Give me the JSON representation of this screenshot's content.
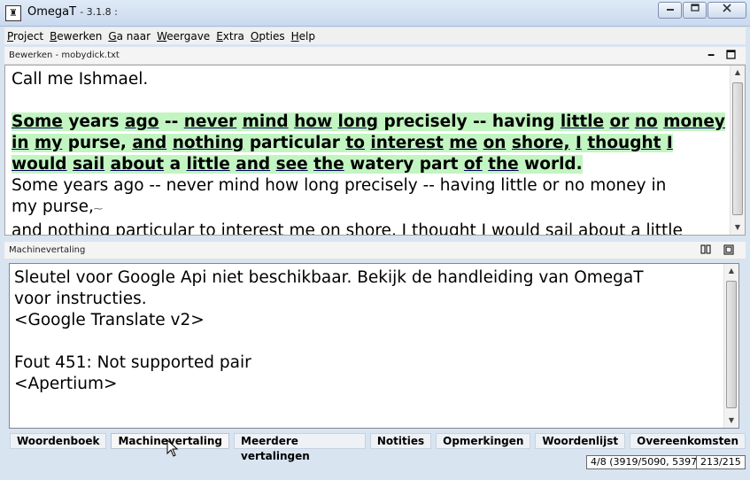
{
  "window": {
    "app_name": "OmegaT",
    "version": "- 3.1.8 :",
    "icon_glyph": "♜"
  },
  "menu": [
    {
      "first": "P",
      "rest": "roject"
    },
    {
      "first": "B",
      "rest": "ewerken"
    },
    {
      "first": "G",
      "rest": "a naar"
    },
    {
      "first": "W",
      "rest": "eergave"
    },
    {
      "first": "E",
      "rest": "xtra"
    },
    {
      "first": "O",
      "rest": "pties"
    },
    {
      "first": "H",
      "rest": "elp"
    }
  ],
  "editor": {
    "title": "Bewerken - mobydick.txt",
    "line1": "Call me Ishmael.",
    "source_segment": "Some years ago -- never mind how long precisely -- having little or no money in my purse, and nothing particular to interest me on shore, I thought I would sail about a little and see the watery part of the world.",
    "target_line1": "Some years ago -- never mind how long precisely -- having little or no money in",
    "target_line2": "my purse,",
    "target_line3": "and nothing particular to interest me on shore, I thought I would sail about a little"
  },
  "mt": {
    "title": "Machinevertaling",
    "text": "Sleutel voor Google Api niet beschikbaar. Bekijk de handleiding van OmegaT\nvoor instructies.\n<Google Translate v2>\n\nFout 451: Not supported pair\n<Apertium>"
  },
  "tabs": [
    "Woordenboek",
    "Machinevertaling",
    "Meerdere vertalingen",
    "Notities",
    "Opmerkingen",
    "Woordenlijst",
    "Overeenkomsten"
  ],
  "active_tab": "Machinevertaling",
  "status": {
    "progress": "4/8 (3919/5090, 5397)",
    "chars": "213/215"
  },
  "colors": {
    "active_segment_bg": "#c2f5c2",
    "glossary_underline": "#00005a"
  }
}
